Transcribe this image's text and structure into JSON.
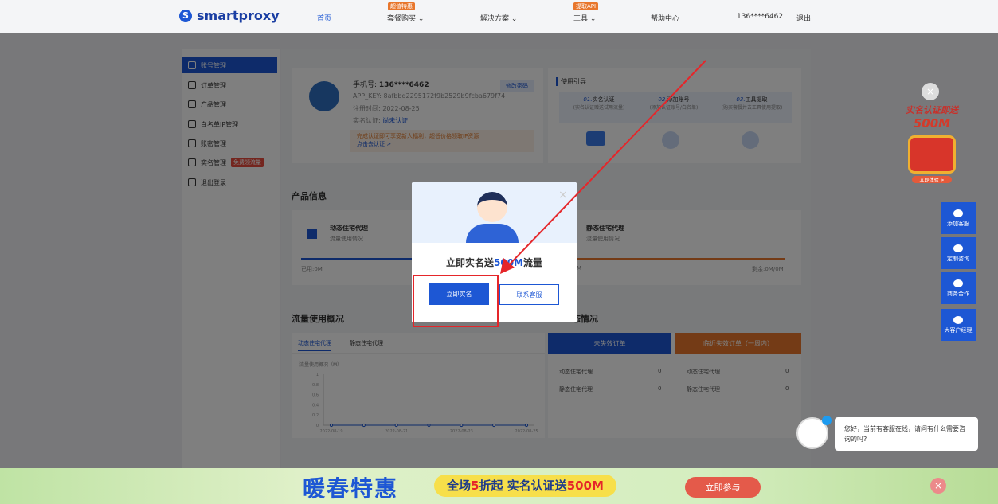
{
  "nav": {
    "logo": "smartproxy",
    "home": "首页",
    "packages": "套餐购买",
    "packages_badge": "超值特惠",
    "solutions": "解决方案",
    "tools": "工具",
    "tools_badge": "提取API",
    "help": "帮助中心",
    "user": "136****6462",
    "logout": "退出"
  },
  "sidebar": {
    "items": [
      {
        "label": "账号管理"
      },
      {
        "label": "订单管理"
      },
      {
        "label": "产品管理"
      },
      {
        "label": "白名单IP管理"
      },
      {
        "label": "账密管理"
      },
      {
        "label": "实名管理",
        "tag": "免费领流量"
      },
      {
        "label": "退出登录"
      }
    ]
  },
  "profile": {
    "phone_label": "手机号:",
    "phone": "136****6462",
    "app_key": "APP_KEY: 8afbbd2295172f9b2529b9fcba679f74",
    "register_time": "注册时间: 2022-08-25",
    "auth_label": "实名认证:",
    "auth_status": "尚未认证",
    "notice": "完成认证即可享受新人福利，超低价格领取IP资源",
    "notice_link": "点击去认证 >",
    "change_pw": "修改密码"
  },
  "guide": {
    "title": "使用引导",
    "steps": [
      {
        "num": "01.",
        "title": "实名认证",
        "desc": "(实名认证赠送试用流量)"
      },
      {
        "num": "02.",
        "title": "添加账号",
        "desc": "(添加认证账号/白名单)"
      },
      {
        "num": "03.",
        "title": "工具提取",
        "desc": "(购买套餐并去工具使用提取)"
      }
    ]
  },
  "products": {
    "title": "产品信息",
    "dynamic": {
      "name": "动态住宅代理",
      "sub": "流量使用情况",
      "used": "已用:0M"
    },
    "static": {
      "name": "静态住宅代理",
      "sub": "流量使用情况",
      "used_tail": "M",
      "remain": "剩余:0M/0M"
    }
  },
  "usage": {
    "title": "流量使用概况",
    "tabs": [
      "动态住宅代理",
      "静态住宅代理"
    ],
    "chart_title": "流量使用概况（M）"
  },
  "orders": {
    "title_tail": "态情况",
    "unexpired": "未失效订单",
    "expiring": "临近失效订单（一周内）",
    "rows": [
      {
        "name": "动态住宅代理",
        "val": "0"
      },
      {
        "name": "静态住宅代理",
        "val": "0"
      }
    ]
  },
  "modal": {
    "title_prefix": "立即实名送",
    "title_highlight": "500M",
    "title_suffix": "流量",
    "primary": "立即实名",
    "secondary": "联系客服",
    "close": "×"
  },
  "promo": {
    "line1": "实名认证即送",
    "line2": "500M",
    "btn": "立即体验 >"
  },
  "right_tools": [
    "添加客服",
    "定制咨询",
    "商务合作",
    "大客户经理"
  ],
  "chat": {
    "message": "您好，当前有客服在线，请问有什么需要咨询的吗?"
  },
  "banner": {
    "title": "暖春特惠",
    "slogan_a": "全场",
    "slogan_b": "5",
    "slogan_c": "折起  实名认证送",
    "slogan_d": "500M",
    "join": "立即参与"
  },
  "chart_data": {
    "type": "line",
    "x": [
      "2022-08-19",
      "2022-08-20",
      "2022-08-21",
      "2022-08-22",
      "2022-08-23",
      "2022-08-24",
      "2022-08-25"
    ],
    "series": [
      {
        "values": [
          0,
          0,
          0,
          0,
          0,
          0,
          0
        ]
      }
    ],
    "y_ticks": [
      "0",
      "0.2",
      "0.4",
      "0.6",
      "0.8",
      "1"
    ],
    "ylim": [
      0,
      1
    ],
    "x_tick_labels": [
      "2022-08-19",
      "2022-08-21",
      "2022-08-23",
      "2022-08-25"
    ],
    "color": "#1d57d4"
  }
}
